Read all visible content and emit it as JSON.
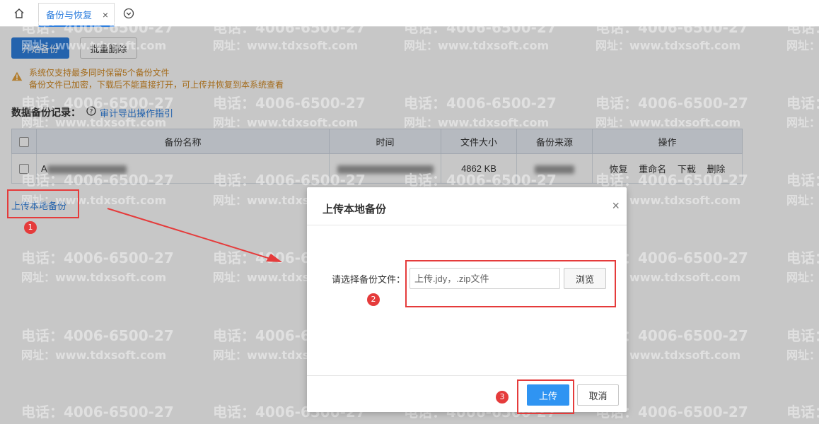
{
  "tabs": {
    "home_icon": "home-icon",
    "active_label": "备份与恢复",
    "close_glyph": "×",
    "more_icon": "chevron-down-circle-icon"
  },
  "toolbar": {
    "start_backup": "开始备份",
    "batch_delete": "批量删除"
  },
  "warning": {
    "icon": "warning-icon",
    "line1": "系统仅支持最多同时保留5个备份文件",
    "line2": "备份文件已加密，下载后不能直接打开，可上传并恢复到本系统查看",
    "color": "#d28a23"
  },
  "records": {
    "title": "数据备份记录：",
    "guide_link": "审计导出操作指引"
  },
  "table": {
    "headers": [
      "备份名称",
      "时间",
      "文件大小",
      "备份来源",
      "操作"
    ],
    "row": {
      "name_visible": "A",
      "size": "4862 KB",
      "actions": [
        "恢复",
        "重命名",
        "下载",
        "删除"
      ]
    }
  },
  "upload_local_link": "上传本地备份",
  "watermark": {
    "phone": "电话：4006-6500-27",
    "site": "网址：www.tdxsoft.com"
  },
  "dialog": {
    "title": "上传本地备份",
    "close_glyph": "×",
    "file_label": "请选择备份文件：",
    "file_placeholder": "上传.jdy，.zip文件",
    "browse": "浏览",
    "upload": "上传",
    "cancel": "取消"
  },
  "annotations": {
    "step1": "1",
    "step2": "2",
    "step3": "3",
    "color": "#e53b3b"
  },
  "colors": {
    "primary": "#2f7fde",
    "upload_button": "#2f94f2"
  }
}
